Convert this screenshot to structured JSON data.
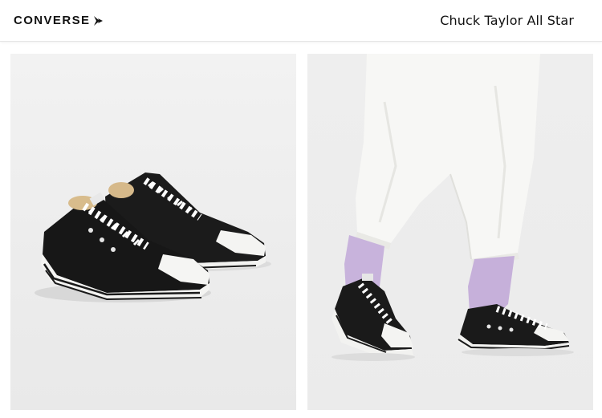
{
  "header": {
    "brand": "CONVERSE",
    "product_title": "Chuck Taylor All Star"
  },
  "gallery": {
    "images": [
      {
        "subject": "pair of black low-top sneakers with white laces, toe caps and soles"
      },
      {
        "subject": "model wearing white trousers, lilac socks and black low-top sneakers"
      }
    ]
  },
  "colors": {
    "shoe_black": "#1a1a1a",
    "sole_white": "#f4f4f2",
    "sock_lilac": "#c8b3dc",
    "trouser_white": "#f6f6f4",
    "background": "#ececec"
  },
  "icons": {
    "brand_mark": "chevron-star-icon"
  }
}
